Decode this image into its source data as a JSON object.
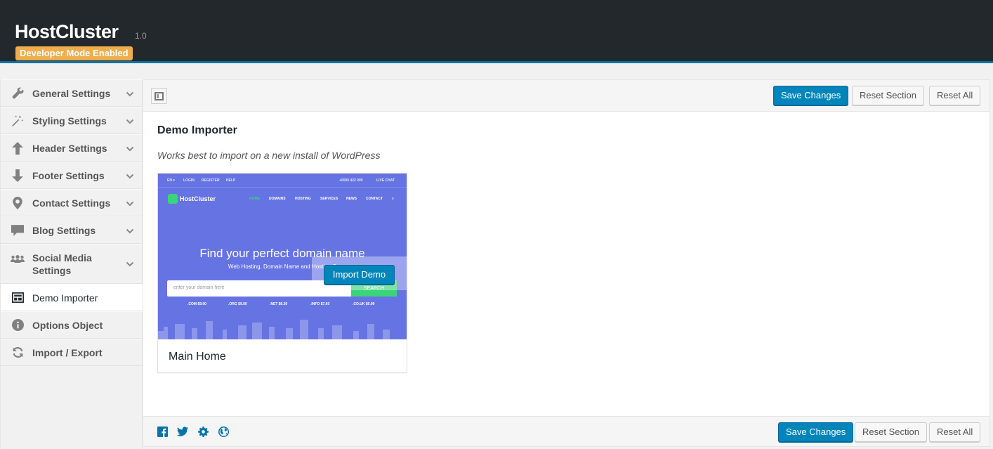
{
  "header": {
    "title": "HostCluster",
    "version": "1.0",
    "badge": "Developer Mode Enabled"
  },
  "sidebar": {
    "items": [
      {
        "label": "General Settings",
        "icon": "wrench-icon"
      },
      {
        "label": "Styling Settings",
        "icon": "magic-wand-icon"
      },
      {
        "label": "Header Settings",
        "icon": "arrow-up-icon"
      },
      {
        "label": "Footer Settings",
        "icon": "arrow-down-icon"
      },
      {
        "label": "Contact Settings",
        "icon": "location-pin-icon"
      },
      {
        "label": "Blog Settings",
        "icon": "speech-bubble-icon"
      },
      {
        "label": "Social Media Settings",
        "icon": "users-icon"
      },
      {
        "label": "Demo Importer",
        "icon": "layout-icon",
        "active": true
      },
      {
        "label": "Options Object",
        "icon": "info-icon"
      },
      {
        "label": "Import / Export",
        "icon": "refresh-icon"
      }
    ]
  },
  "toolbar": {
    "save_label": "Save Changes",
    "reset_section_label": "Reset Section",
    "reset_all_label": "Reset All"
  },
  "section": {
    "title": "Demo Importer",
    "description": "Works best to import on a new install of WordPress"
  },
  "demo": {
    "name": "Main Home",
    "import_label": "Import Demo",
    "preview": {
      "top_links": [
        "EN ▾",
        "LOGIN",
        "REGISTER",
        "HELP"
      ],
      "phone": "+0000 422 000",
      "chat": "LIVE CHAT",
      "logo": "HostCluster",
      "menu": [
        "HOME",
        "DOMAINS",
        "HOSTING",
        "SERVICES",
        "NEWS",
        "CONTACT"
      ],
      "hero": "Find your perfect domain name",
      "subtitle": "Web Hosting, Domain Name and Hosting C",
      "search_placeholder": "enter your domain here",
      "search_button": "SEARCH",
      "prices": [
        ".COM $9.00",
        ".ORG $9.50",
        ".NET $6.50",
        ".INFO $7.50",
        ".CO.UK $0.99"
      ]
    }
  },
  "footer": {
    "social": [
      "facebook-icon",
      "twitter-icon",
      "gear-icon",
      "globe-icon"
    ]
  },
  "colors": {
    "accent": "#0085ba",
    "header_bg": "#23282d",
    "badge": "#f0ad4e",
    "demo_bg": "#6673e3",
    "demo_green": "#3bd47a"
  }
}
